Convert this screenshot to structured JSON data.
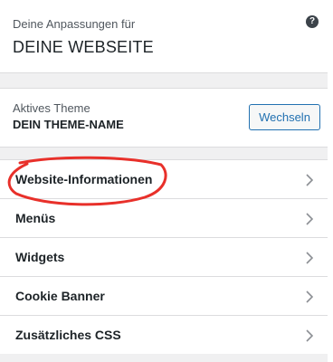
{
  "info": {
    "subtitle": "Deine Anpassungen für",
    "title": "DEINE WEBSEITE",
    "help_glyph": "?"
  },
  "theme": {
    "label": "Aktives Theme",
    "name": "DEIN THEME-NAME",
    "change_label": "Wechseln"
  },
  "menu": {
    "items": [
      {
        "label": "Website-Informationen",
        "icon": "chevron-right-icon"
      },
      {
        "label": "Menüs",
        "icon": "chevron-right-icon"
      },
      {
        "label": "Widgets",
        "icon": "chevron-right-icon"
      },
      {
        "label": "Cookie Banner",
        "icon": "chevron-right-icon"
      },
      {
        "label": "Zusätzliches CSS",
        "icon": "chevron-right-icon"
      }
    ]
  },
  "colors": {
    "accent": "#2271b1",
    "annotation": "#e8302a"
  }
}
